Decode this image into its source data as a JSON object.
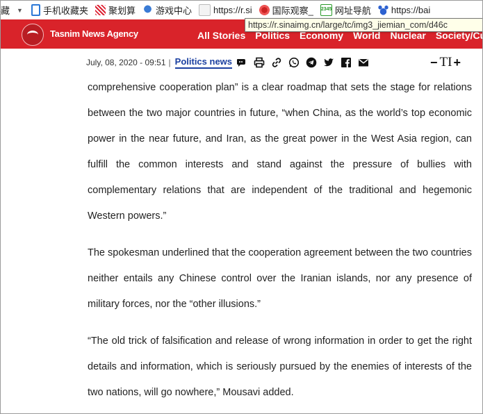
{
  "bookmarks": {
    "items": [
      {
        "label": "藏",
        "icon": "none"
      },
      {
        "label": "手机收藏夹",
        "icon": "phone-icon"
      },
      {
        "label": "聚划算",
        "icon": "juhuasuan-icon"
      },
      {
        "label": "游戏中心",
        "icon": "qq-game-icon"
      },
      {
        "label": "https://r.si",
        "icon": "page-icon"
      },
      {
        "label": "国际观察_",
        "icon": "globe-icon"
      },
      {
        "label": "网址导航",
        "icon": "2345-icon"
      },
      {
        "label": "https://bai",
        "icon": "baidu-paw-icon"
      }
    ],
    "caret": "▼",
    "icon_2345_text": "2345"
  },
  "tooltip": {
    "text": "https://r.sinaimg.cn/large/tc/img3_jiemian_com/d46c"
  },
  "site": {
    "brand": "Tasnim News Agency",
    "nav": [
      "All Stories",
      "Politics",
      "Economy",
      "World",
      "Nuclear",
      "Society/Cu"
    ],
    "header_color": "#d9232a"
  },
  "meta": {
    "date": "July, 08, 2020 - 09:51",
    "separator": "|",
    "category": "Politics news",
    "share_icons": [
      "comment-icon",
      "print-icon",
      "link-icon",
      "whatsapp-icon",
      "telegram-icon",
      "twitter-icon",
      "facebook-icon",
      "email-icon"
    ],
    "font_decrease": "−",
    "font_label": "TI",
    "font_increase": "+"
  },
  "article": {
    "paragraphs": [
      "comprehensive cooperation plan” is a clear roadmap that sets the stage for relations between the two major countries in future, “when China, as the world’s top economic power in the near future, and Iran, as the great power in the West Asia region, can fulfill the common interests and stand against the pressure of bullies with complementary relations that are independent of the traditional and hegemonic Western powers.”",
      "The spokesman underlined that the cooperation agreement between the two countries neither entails any Chinese control over the Iranian islands, nor any presence of military forces, nor the “other illusions.”",
      "“The old trick of falsification and release of wrong information in order to get the right details and information, which is seriously pursued by the enemies of interests of the two nations, will go nowhere,” Mousavi added."
    ]
  }
}
